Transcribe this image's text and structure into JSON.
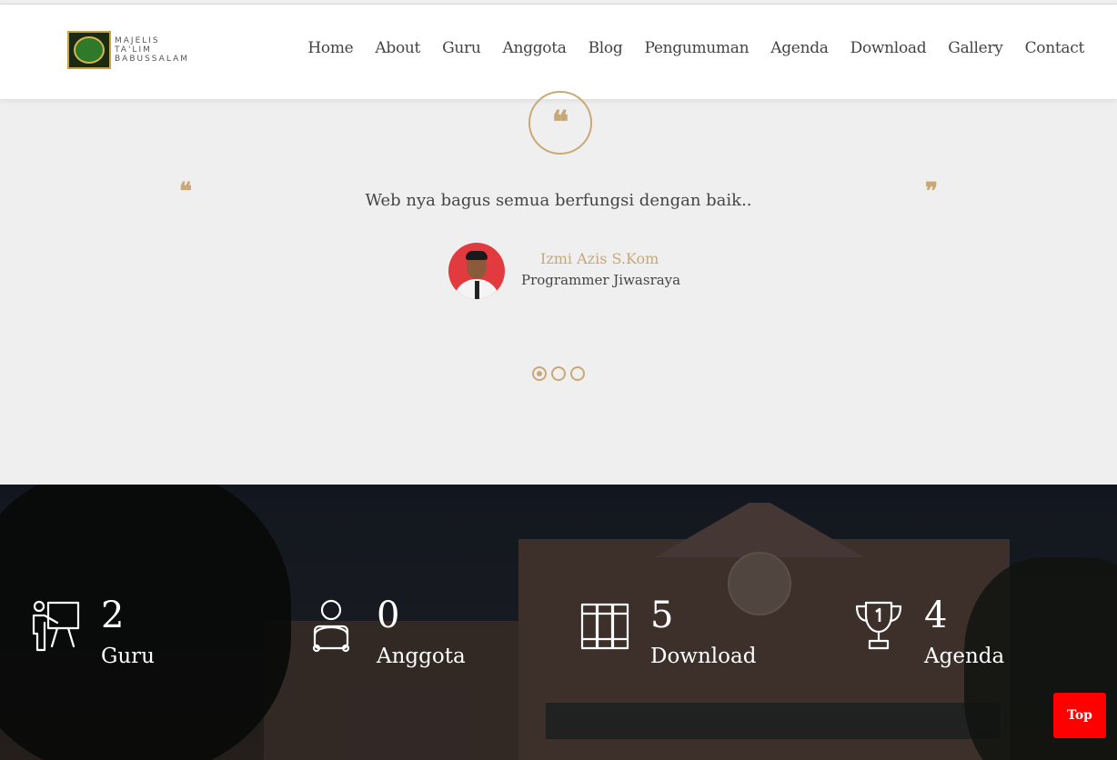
{
  "header": {
    "logo_text": [
      "MAJELIS",
      "TA'LIM",
      "BABUSSALAM"
    ],
    "nav": [
      "Home",
      "About",
      "Guru",
      "Anggota",
      "Blog",
      "Pengumuman",
      "Agenda",
      "Download",
      "Gallery",
      "Contact"
    ]
  },
  "testimonial": {
    "text": "Web nya bagus semua berfungsi dengan baik..",
    "author": "Izmi Azis S.Kom",
    "role": "Programmer Jiwasraya",
    "quote_glyph_open": "❝",
    "quote_glyph_close": "❞",
    "slides": 3,
    "active_slide": 1
  },
  "stats": [
    {
      "icon": "teacher-icon",
      "number": "2",
      "label": "Guru"
    },
    {
      "icon": "member-icon",
      "number": "0",
      "label": "Anggota"
    },
    {
      "icon": "books-icon",
      "number": "5",
      "label": "Download"
    },
    {
      "icon": "trophy-icon",
      "number": "4",
      "label": "Agenda"
    }
  ],
  "top_button": "Top",
  "colors": {
    "accent": "#c8a877",
    "top_button": "#ff0000",
    "text": "#444444"
  }
}
